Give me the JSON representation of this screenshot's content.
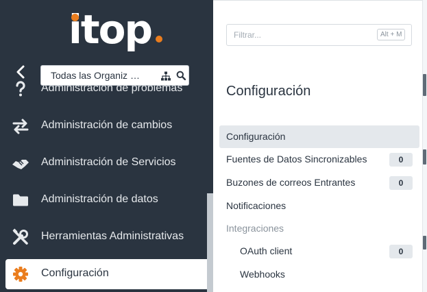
{
  "brand": {
    "logo_text": "itop",
    "accent": "#ea7d1e"
  },
  "sidebar": {
    "org_selector": {
      "value": "Todas las Organiz …"
    },
    "items": [
      {
        "label": "Administración de problemas",
        "icon": "question-icon"
      },
      {
        "label": "Administración de cambios",
        "icon": "exchange-arrows-icon"
      },
      {
        "label": "Administración de Servicios",
        "icon": "handshake-icon"
      },
      {
        "label": "Administración de datos",
        "icon": "folder-icon"
      },
      {
        "label": "Herramientas Administrativas",
        "icon": "tools-icon"
      },
      {
        "label": "Configuración",
        "icon": "gear-icon",
        "active": true
      }
    ]
  },
  "panel": {
    "filter": {
      "placeholder": "Filtrar...",
      "shortcut": "Alt + M"
    },
    "title": "Configuración",
    "items": [
      {
        "label": "Configuración",
        "selected": true
      },
      {
        "label": "Fuentes de Datos Sincronizables",
        "count": "0"
      },
      {
        "label": "Buzones de correos Entrantes",
        "count": "0"
      },
      {
        "label": "Notificaciones"
      },
      {
        "label": "Integraciones",
        "group": true
      },
      {
        "label": "OAuth client",
        "count": "0",
        "indent": true
      },
      {
        "label": "Webhooks",
        "indent": true
      }
    ]
  }
}
